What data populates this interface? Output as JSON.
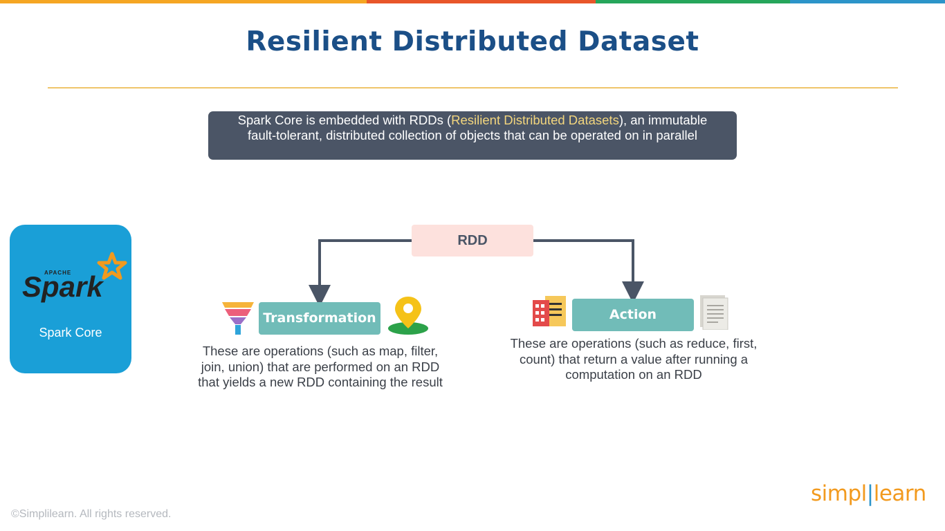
{
  "colors": {
    "title": "#1b4f87",
    "accent_rule": "#efc56a",
    "info_box_bg": "#4b5566",
    "highlight": "#f3d67e",
    "spark_card": "#1a9fd7",
    "rdd_box": "#fde1dd",
    "op_box": "#71bcb8",
    "connector": "#4a5566",
    "top_bar": [
      "#f5a623",
      "#e8562a",
      "#26a65b",
      "#2c94c9"
    ]
  },
  "title": "Resilient Distributed Dataset",
  "info": {
    "part1": "Spark Core is embedded with ",
    "rdds": "RDDs",
    "open_paren": " (",
    "highlight": "Resilient Distributed Datasets",
    "part2": "), an immutable fault-tolerant, distributed collection of objects that can be operated on in parallel"
  },
  "spark_card": {
    "logo_small": "APACHE",
    "logo_text": "Spark",
    "caption": "Spark Core"
  },
  "diagram": {
    "root": "RDD",
    "transformation": {
      "label": "Transformation",
      "description": "These are operations (such as map, filter, join, union) that are performed on an RDD that yields a new RDD containing the result",
      "icons": [
        "funnel-icon",
        "map-pin-icon"
      ]
    },
    "action": {
      "label": "Action",
      "description": "These are operations (such as reduce, first, count) that return a value after running a computation on an RDD",
      "icons": [
        "spreadsheet-icon",
        "document-icon"
      ]
    }
  },
  "footer": {
    "copyright": "©Simplilearn. All rights reserved.",
    "brand_left": "simpl",
    "brand_right": "learn"
  }
}
